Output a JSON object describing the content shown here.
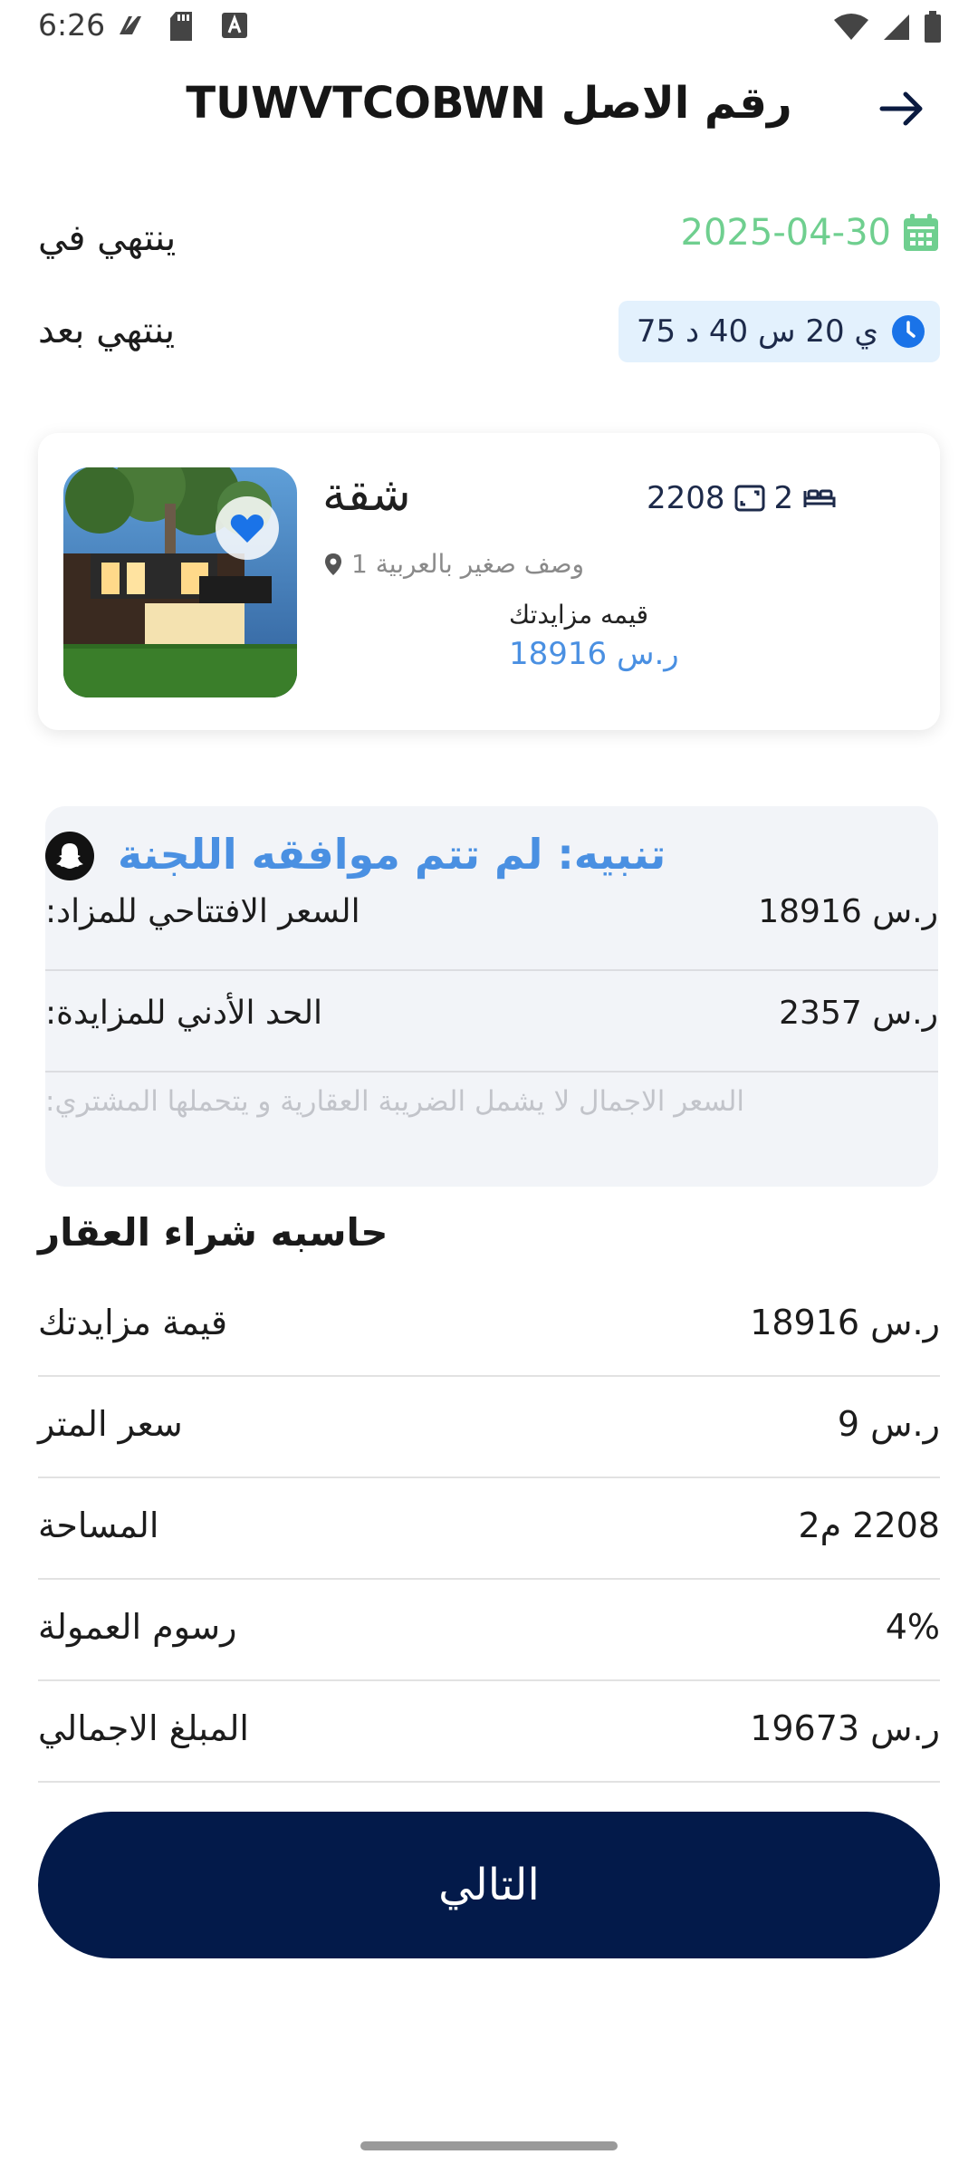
{
  "status_bar": {
    "time": "6:26",
    "left_icons": [
      "nfc-icon",
      "sd-card-icon",
      "font-icon"
    ],
    "right_icons": [
      "wifi-icon",
      "signal-icon",
      "battery-icon"
    ]
  },
  "header": {
    "title": "رقم الاصل TUWVTCOBWN",
    "back_icon": "arrow-right-icon"
  },
  "ends_on": {
    "label": "ينتهي في",
    "date": "2025-04-30",
    "icon": "calendar-icon",
    "color": "#6fcf8f"
  },
  "ends_after": {
    "label": "ينتهي بعد",
    "countdown": "ي 20 س 40 د 75",
    "icon": "clock-icon"
  },
  "property_card": {
    "type": "شقة",
    "beds": "2",
    "area": "2208",
    "location": "وصف صغير بالعربية 1",
    "bid_label": "قيمه مزايدتك",
    "bid_value": "ر.س 18916",
    "favorite_icon": "heart-icon"
  },
  "alert": {
    "title": "تنبيه: لم تتم موافقه اللجنة",
    "icon": "snapchat-ghost-icon",
    "rows": [
      {
        "label": "السعر الافتتاحي للمزاد:",
        "value": "ر.س 18916"
      },
      {
        "label": "الحد الأدني للمزايدة:",
        "value": "ر.س 2357"
      }
    ],
    "note": "السعر الاجمال لا يشمل الضريبة العقارية و يتحملها المشتري:"
  },
  "calculator": {
    "title": "حاسبه شراء  العقار",
    "rows": [
      {
        "label": "قيمة مزايدتك",
        "value": "ر.س 18916"
      },
      {
        "label": "سعر المتر",
        "value": "ر.س 9"
      },
      {
        "label": "المساحة",
        "value": "2208 م2"
      },
      {
        "label": "رسوم العمولة",
        "value": "4%"
      },
      {
        "label": "المبلغ الاجمالي",
        "value": "ر.س 19673"
      }
    ]
  },
  "next_button": {
    "label": "التالي",
    "color": "#031a4a"
  },
  "colors": {
    "accent_blue": "#4a90e2",
    "navy": "#031a4a",
    "green": "#6fcf8f"
  }
}
